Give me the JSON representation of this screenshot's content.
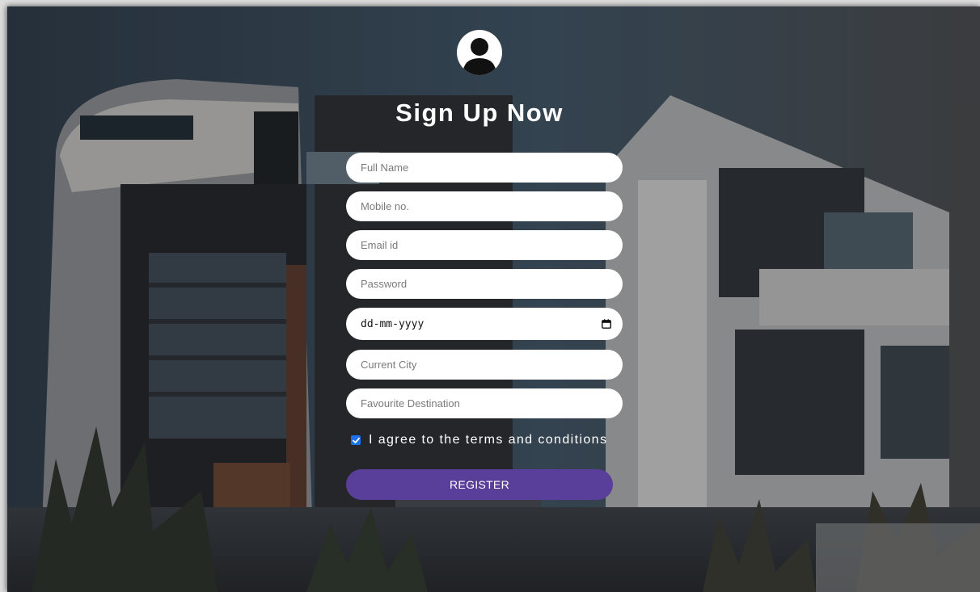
{
  "header": {
    "title": "Sign Up Now",
    "avatar_icon": "user-icon"
  },
  "form": {
    "full_name": {
      "placeholder": "Full Name",
      "value": ""
    },
    "mobile": {
      "placeholder": "Mobile no.",
      "value": ""
    },
    "email": {
      "placeholder": "Email id",
      "value": ""
    },
    "password": {
      "placeholder": "Password",
      "value": ""
    },
    "dob": {
      "placeholder": "dd-mm-yyyy",
      "icon": "calendar-icon"
    },
    "city": {
      "placeholder": "Current City",
      "value": ""
    },
    "destination": {
      "placeholder": "Favourite Destination",
      "value": ""
    },
    "terms": {
      "label": "I agree to the terms and conditions",
      "checked": true
    },
    "register_label": "REGISTER"
  },
  "colors": {
    "button": "#5a3f9a",
    "checkbox": "#1a73e8",
    "title": "#ffffff"
  }
}
